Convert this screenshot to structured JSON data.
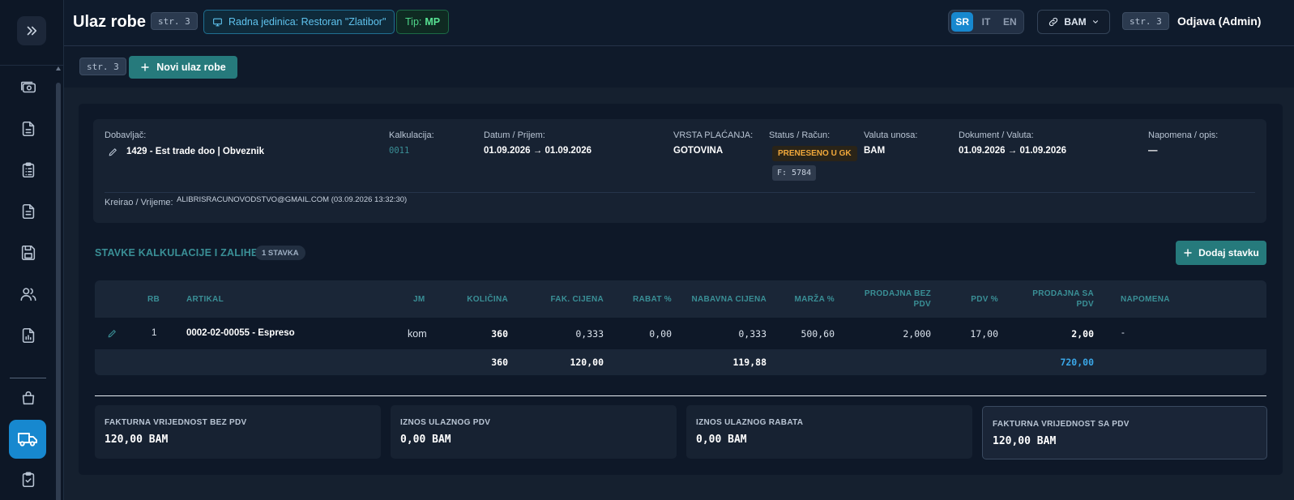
{
  "header": {
    "title": "Ulaz robe",
    "page_tag": "str. 3",
    "unit_label": "Radna jedinica: Restoran \"Zlatibor\"",
    "tip_prefix": "Tip:",
    "tip_value": "MP",
    "languages": [
      "SR",
      "IT",
      "EN"
    ],
    "active_language": "SR",
    "currency": "BAM",
    "page_tag_right": "str. 3",
    "logout": "Odjava (Admin)"
  },
  "subbar": {
    "page_tag": "str. 3",
    "new_button": "Novi ulaz robe"
  },
  "info": {
    "supplier_label": "Dobavljač:",
    "supplier_value": "1429 - Est trade doo | Obveznik",
    "calc_label": "Kalkulacija:",
    "calc_value": "0011",
    "date_label": "Datum / Prijem:",
    "date_value": "01.09.2026 → 01.09.2026",
    "payment_label": "VRSTA PLAĆANJA:",
    "payment_value": "GOTOVINA",
    "status_label": "Status / Račun:",
    "status_value": "PRENESENO U GK",
    "invoice_value": "F: 5784",
    "input_currency_label": "Valuta unosa:",
    "input_currency_value": "BAM",
    "doc_label": "Dokument / Valuta:",
    "doc_value": "01.09.2026 → 01.09.2026",
    "note_label": "Napomena / opis:",
    "note_value": "—",
    "created_label": "Kreirao / Vrijeme:",
    "created_value": "ALIBRISRACUNOVODSTVO@GMAIL.COM (03.09.2026 13:32:30)"
  },
  "section": {
    "title": "STAVKE KALKULACIJE I ZALIHE",
    "count": "1 STAVKA",
    "add_button": "Dodaj stavku"
  },
  "table": {
    "headers": {
      "rb": "RB",
      "artikal": "ARTIKAL",
      "jm": "JM",
      "kolicina": "KOLIČINA",
      "fak_cijena": "FAK. CIJENA",
      "rabat": "RABAT %",
      "nabavna": "NABAVNA CIJENA",
      "marza": "MARŽA %",
      "prodajna_bez_1": "PRODAJNA BEZ",
      "prodajna_bez_2": "PDV",
      "pdv": "PDV %",
      "prodajna_sa_1": "PRODAJNA SA",
      "prodajna_sa_2": "PDV",
      "napomena": "NAPOMENA"
    },
    "row": {
      "rb": "1",
      "artikal": "0002-02-00055 - Espreso",
      "jm": "kom",
      "kolicina": "360",
      "fak_cijena": "0,333",
      "rabat": "0,00",
      "nabavna": "0,333",
      "marza": "500,60",
      "prodajna_bez": "2,000",
      "pdv": "17,00",
      "prodajna_sa": "2,00",
      "napomena": "-"
    },
    "sum": {
      "kolicina": "360",
      "fak_cijena": "120,00",
      "nabavna": "119,88",
      "prodajna_sa": "720,00"
    }
  },
  "totals": [
    {
      "label": "FAKTURNA VRIJEDNOST BEZ PDV",
      "value": "120,00 BAM"
    },
    {
      "label": "IZNOS ULAZNOG PDV",
      "value": "0,00 BAM"
    },
    {
      "label": "IZNOS ULAZNOG RABATA",
      "value": "0,00 BAM"
    },
    {
      "label": "FAKTURNA VRIJEDNOST SA PDV",
      "value": "120,00 BAM"
    }
  ],
  "colors": {
    "accent_teal": "#267a7c",
    "accent_blue": "#1788cf",
    "header_text_teal": "#3a8f96",
    "status_orange": "#f2a93b",
    "sum_blue": "#3aa7e8"
  },
  "icons": {
    "sidebar_toggle": "chevrons-right-icon",
    "sidebar_items": [
      "cash-icon",
      "document-icon",
      "clipboard-list-icon",
      "document-lines-icon",
      "save-icon",
      "users-icon",
      "report-icon",
      "shopping-bag-icon",
      "truck-icon",
      "clipboard-check-icon"
    ]
  }
}
